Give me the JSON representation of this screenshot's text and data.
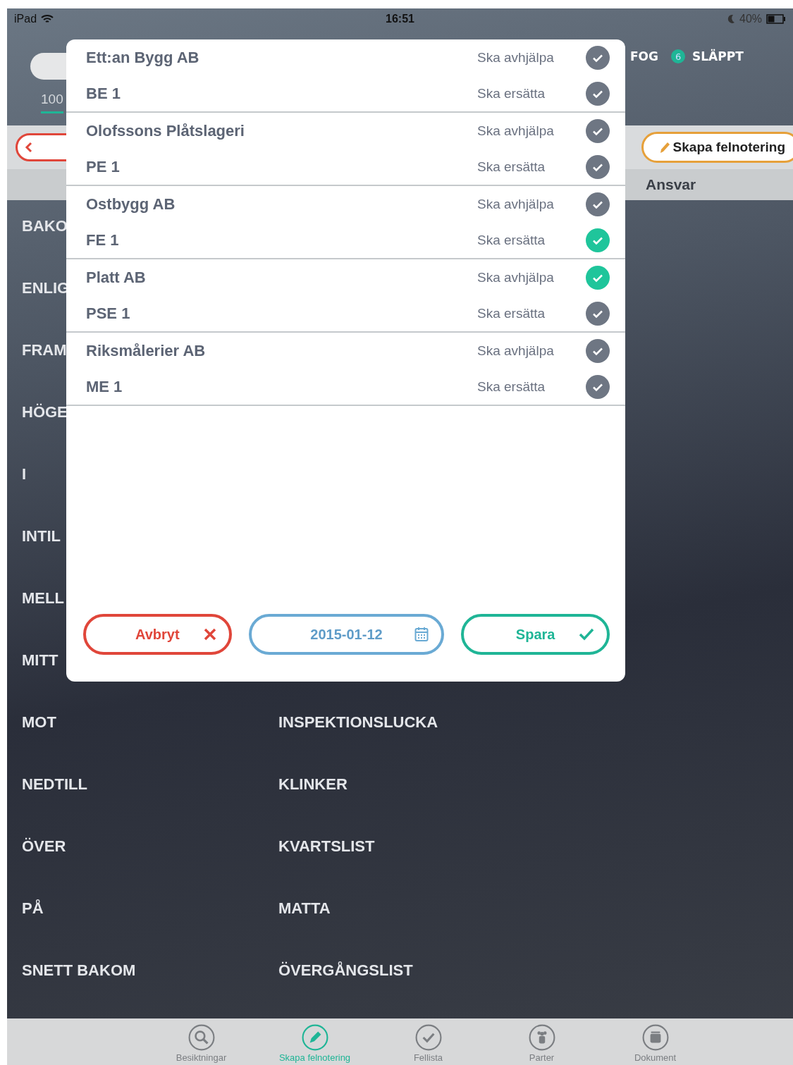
{
  "status_bar": {
    "carrier": "iPad",
    "time": "16:51",
    "battery": "40%"
  },
  "header": {
    "tab_value": "100",
    "labels": [
      "FOG",
      "SLÄPPT"
    ],
    "badge": "6"
  },
  "toolbar": {
    "action_button": "Skapa felnotering"
  },
  "section_header": "Ansvar",
  "list": [
    {
      "left": "BAKO"
    },
    {
      "left": "ENLIG"
    },
    {
      "left": "FRAM"
    },
    {
      "left": "HÖGE"
    },
    {
      "left": "I"
    },
    {
      "left": "INTIL"
    },
    {
      "left": "MELL"
    },
    {
      "left": "MITT"
    },
    {
      "left": "MOT",
      "right": "INSPEKTIONSLUCKA"
    },
    {
      "left": "NEDTILL",
      "right": "KLINKER"
    },
    {
      "left": "ÖVER",
      "right": "KVARTSLIST"
    },
    {
      "left": "PÅ",
      "right": "MATTA"
    },
    {
      "left": "SNETT BAKOM",
      "right": "ÖVERGÅNGSLIST"
    }
  ],
  "dialog": {
    "groups": [
      {
        "company": "Ett:an Bygg AB",
        "code": "BE 1",
        "options": [
          {
            "label": "Ska avhjälpa",
            "checked": false
          },
          {
            "label": "Ska ersätta",
            "checked": false
          }
        ]
      },
      {
        "company": "Olofssons Plåtslageri",
        "code": "PE 1",
        "options": [
          {
            "label": "Ska avhjälpa",
            "checked": false
          },
          {
            "label": "Ska ersätta",
            "checked": false
          }
        ]
      },
      {
        "company": "Ostbygg AB",
        "code": "FE 1",
        "options": [
          {
            "label": "Ska avhjälpa",
            "checked": false
          },
          {
            "label": "Ska ersätta",
            "checked": true
          }
        ]
      },
      {
        "company": "Platt AB",
        "code": "PSE 1",
        "options": [
          {
            "label": "Ska avhjälpa",
            "checked": true
          },
          {
            "label": "Ska ersätta",
            "checked": false
          }
        ]
      },
      {
        "company": "Riksmålerier AB",
        "code": "ME 1",
        "options": [
          {
            "label": "Ska avhjälpa",
            "checked": false
          },
          {
            "label": "Ska ersätta",
            "checked": false
          }
        ]
      }
    ],
    "buttons": [
      {
        "kind": "cancel",
        "label": "Avbryt"
      },
      {
        "kind": "date",
        "label": "2015-01-12"
      },
      {
        "kind": "save",
        "label": "Spara"
      }
    ]
  },
  "tab_bar": [
    {
      "kind": "search",
      "label": "Besiktningar",
      "selected": false
    },
    {
      "kind": "pencil",
      "label": "Skapa felnotering",
      "selected": true
    },
    {
      "kind": "check",
      "label": "Fellista",
      "selected": false
    },
    {
      "kind": "people",
      "label": "Parter",
      "selected": false
    },
    {
      "kind": "box",
      "label": "Dokument",
      "selected": false
    }
  ]
}
